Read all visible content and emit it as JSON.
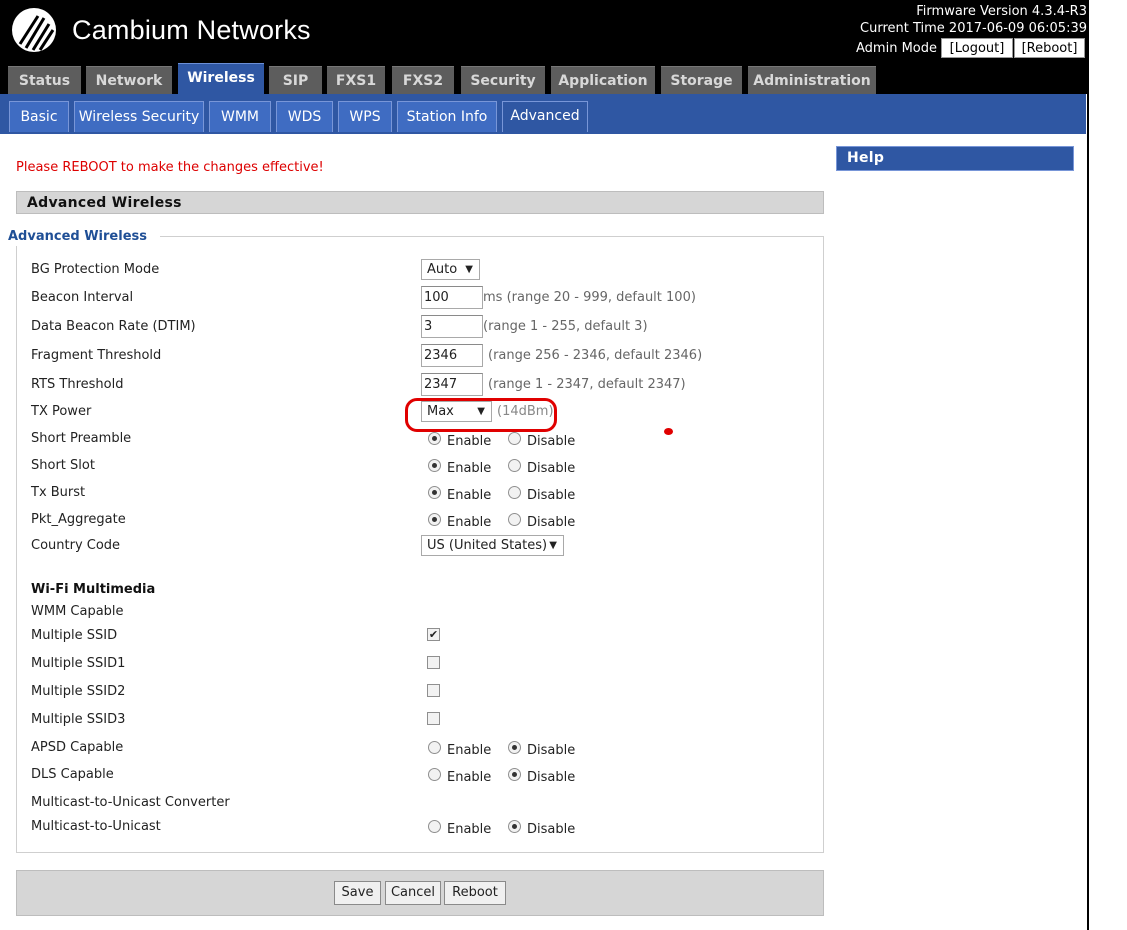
{
  "header": {
    "brand": "Cambium Networks",
    "firmware": "Firmware Version 4.3.4-R3",
    "current_time": "Current Time 2017-06-09 06:05:39",
    "mode": "Admin Mode",
    "logout": "[Logout]",
    "reboot": "[Reboot]"
  },
  "tabs": [
    "Status",
    "Network",
    "Wireless",
    "SIP",
    "FXS1",
    "FXS2",
    "Security",
    "Application",
    "Storage",
    "Administration"
  ],
  "subtabs": [
    "Basic",
    "Wireless Security",
    "WMM",
    "WDS",
    "WPS",
    "Station Info",
    "Advanced"
  ],
  "notice": "Please REBOOT to make the changes effective!",
  "section_title": "Advanced Wireless",
  "legend": "Advanced Wireless",
  "fields": {
    "bg_protection": {
      "label": "BG Protection Mode",
      "value": "Auto"
    },
    "beacon_interval": {
      "label": "Beacon Interval",
      "value": "100",
      "hint": "ms (range 20 - 999, default 100)"
    },
    "dtim": {
      "label": "Data Beacon Rate (DTIM)",
      "value": "3",
      "hint": "(range 1 - 255, default 3)"
    },
    "fragment": {
      "label": "Fragment Threshold",
      "value": "2346",
      "hint": "(range 256 - 2346, default 2346)"
    },
    "rts": {
      "label": "RTS Threshold",
      "value": "2347",
      "hint": "(range 1 - 2347, default 2347)"
    },
    "tx_power": {
      "label": "TX Power",
      "value": "Max",
      "hint": "(14dBm)"
    },
    "short_preamble": {
      "label": "Short Preamble",
      "selected": "Enable"
    },
    "short_slot": {
      "label": "Short Slot",
      "selected": "Enable"
    },
    "tx_burst": {
      "label": "Tx Burst",
      "selected": "Enable"
    },
    "pkt_aggregate": {
      "label": "Pkt_Aggregate",
      "selected": "Enable"
    },
    "country_code": {
      "label": "Country Code",
      "value": "US (United States)"
    }
  },
  "radio_labels": {
    "enable": "Enable",
    "disable": "Disable"
  },
  "wmm": {
    "title": "Wi-Fi Multimedia",
    "wmm_capable": "WMM Capable",
    "multiple_ssid": {
      "label": "Multiple SSID",
      "checked": true
    },
    "multiple_ssid1": {
      "label": "Multiple SSID1",
      "checked": false
    },
    "multiple_ssid2": {
      "label": "Multiple SSID2",
      "checked": false
    },
    "multiple_ssid3": {
      "label": "Multiple SSID3",
      "checked": false
    },
    "apsd": {
      "label": "APSD Capable",
      "selected": "Disable"
    },
    "dls": {
      "label": "DLS Capable",
      "selected": "Disable"
    },
    "m2u_title": "Multicast-to-Unicast Converter",
    "m2u": {
      "label": "Multicast-to-Unicast",
      "selected": "Disable"
    }
  },
  "buttons": {
    "save": "Save",
    "cancel": "Cancel",
    "reboot": "Reboot"
  },
  "help": {
    "title": "Help"
  },
  "colors": {
    "tab_active": "#2f57a3",
    "tab_inactive": "#5d5d5d",
    "notice": "#dd0000",
    "annotation": "#e00000"
  }
}
